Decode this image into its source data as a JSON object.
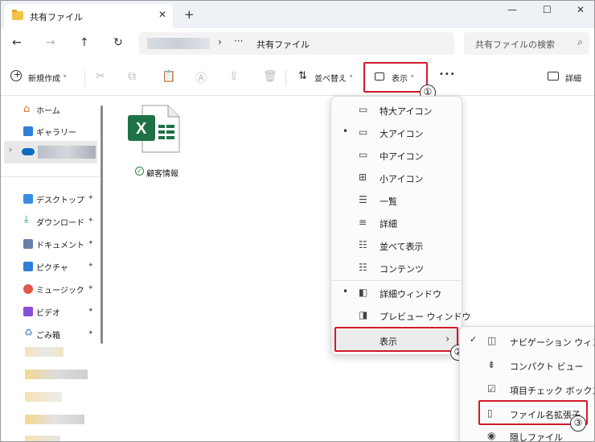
{
  "window": {
    "tab_title": "共有ファイル",
    "tab_close": "✕",
    "new_tab": "+",
    "minimize": "—",
    "maximize": "☐",
    "close": "✕"
  },
  "nav": {
    "back": "←",
    "forward": "→",
    "up": "↑",
    "refresh": "↻",
    "crumb_sep": "›",
    "crumb_more": "···",
    "crumb": "共有ファイル",
    "search_placeholder": "共有ファイルの検索",
    "search_icon": "⌕"
  },
  "toolbar": {
    "new_label": "新規作成",
    "sort_label": "並べ替え",
    "view_label": "表示",
    "more": "•••",
    "details_label": "詳細"
  },
  "sidebar": {
    "items": [
      {
        "label": "ホーム",
        "icon": "home-icon"
      },
      {
        "label": "ギャラリー",
        "icon": "gallery-icon"
      }
    ],
    "quick": [
      {
        "label": "デスクトップ",
        "icon": "desktop-icon",
        "color": "#3a8ee6"
      },
      {
        "label": "ダウンロード",
        "icon": "download-icon",
        "color": "#1a9c6a"
      },
      {
        "label": "ドキュメント",
        "icon": "documents-icon",
        "color": "#6a7fa8"
      },
      {
        "label": "ピクチャ",
        "icon": "pictures-icon",
        "color": "#2f7fd8"
      },
      {
        "label": "ミュージック",
        "icon": "music-icon",
        "color": "#e2584c"
      },
      {
        "label": "ビデオ",
        "icon": "video-icon",
        "color": "#8a4fd8"
      },
      {
        "label": "ごみ箱",
        "icon": "recycle-bin-icon",
        "color": "#5a9bd5"
      }
    ],
    "pin": "📌"
  },
  "content": {
    "file_name": "顧客情報",
    "file_icon_letter": "X",
    "sync_icon": "✓"
  },
  "view_menu": {
    "items": [
      {
        "label": "特大アイコン",
        "icon": "▭",
        "selected": false
      },
      {
        "label": "大アイコン",
        "icon": "▭",
        "selected": true
      },
      {
        "label": "中アイコン",
        "icon": "▭",
        "selected": false
      },
      {
        "label": "小アイコン",
        "icon": "⊞",
        "selected": false
      },
      {
        "label": "一覧",
        "icon": "☰",
        "selected": false
      },
      {
        "label": "詳細",
        "icon": "≡",
        "selected": false
      },
      {
        "label": "並べて表示",
        "icon": "☷",
        "selected": false
      },
      {
        "label": "コンテンツ",
        "icon": "☷",
        "selected": false
      },
      {
        "label": "詳細ウィンドウ",
        "icon": "◧",
        "selected": true
      },
      {
        "label": "プレビュー ウィンドウ",
        "icon": "◨",
        "selected": false
      }
    ],
    "show_label": "表示",
    "show_arrow": "›",
    "selected_dot": "•"
  },
  "show_submenu": {
    "items": [
      {
        "label": "ナビゲーション ウィンドウ",
        "icon": "◫",
        "checked": true
      },
      {
        "label": "コンパクト ビュー",
        "icon": "⇟",
        "checked": false
      },
      {
        "label": "項目チェック ボックス",
        "icon": "☑",
        "checked": false
      },
      {
        "label": "ファイル名拡張子",
        "icon": "▯",
        "checked": false
      },
      {
        "label": "隠しファイル",
        "icon": "◉",
        "checked": false
      }
    ],
    "check": "✓"
  },
  "badges": {
    "one": "①",
    "two": "②",
    "three": "③"
  },
  "colors": {
    "accent": "#d11a2a",
    "excel": "#1e7145"
  }
}
